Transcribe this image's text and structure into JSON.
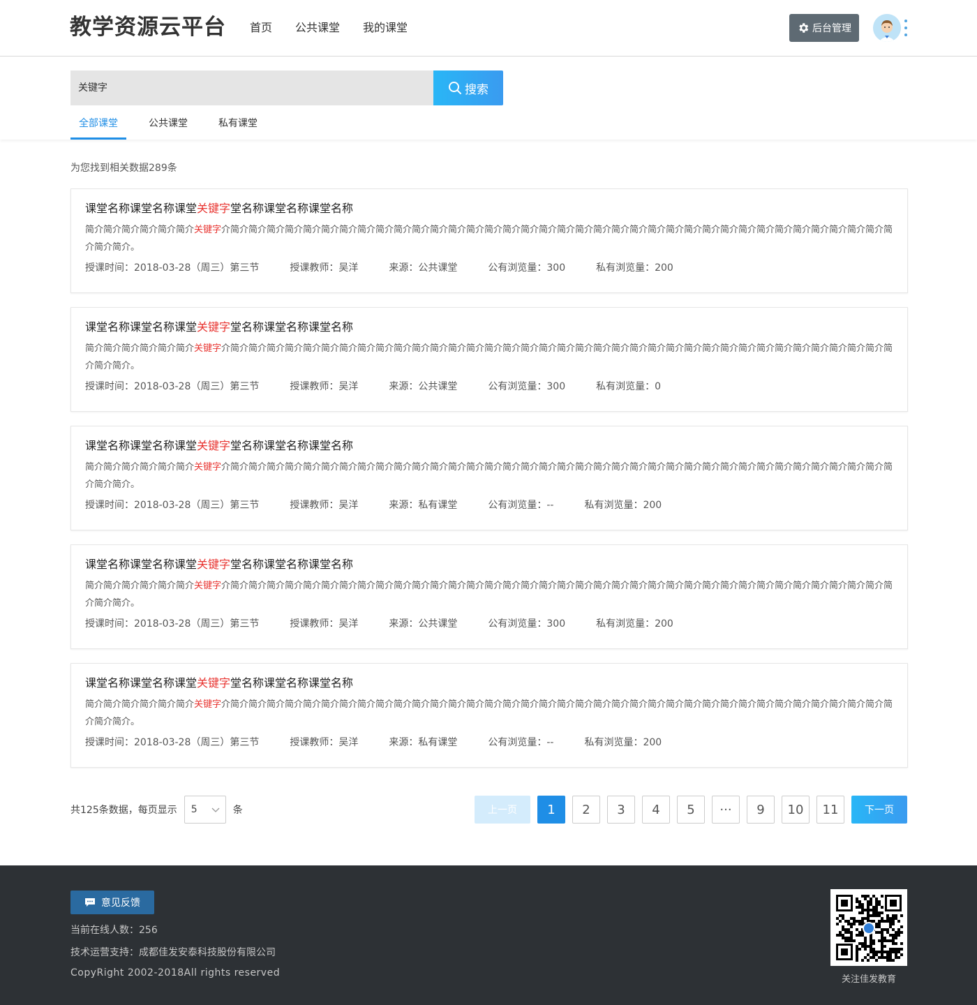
{
  "header": {
    "logo": "教学资源云平台",
    "nav": [
      "首页",
      "公共课堂",
      "我的课堂"
    ],
    "admin_label": "后台管理"
  },
  "search": {
    "placeholder": "关键字",
    "button_label": "搜索"
  },
  "tabs": [
    {
      "label": "全部课堂",
      "active": true
    },
    {
      "label": "公共课堂",
      "active": false
    },
    {
      "label": "私有课堂",
      "active": false
    }
  ],
  "result_count": "为您找到相关数据289条",
  "cards": [
    {
      "title_pre": "课堂名称课堂名称课堂",
      "title_kw": "关键字",
      "title_post": "堂名称课堂名称课堂名称",
      "desc_pre": "简介简介简介简介简介简介",
      "desc_kw": "关键字",
      "desc_post": "介简介简介简介简介简介简介简介简介简介简介简介简介简介简介简介简介简介简介简介简介简介简介简介简介简介简介简介简介简介简介简介简介简介简介简介简介简介简介简介。",
      "time": "授课时间：2018-03-28（周三）第三节",
      "teacher": "授课教师：吴洋",
      "source": "来源：公共课堂",
      "public_views": "公有浏览量：300",
      "private_views": "私有浏览量：200"
    },
    {
      "title_pre": "课堂名称课堂名称课堂",
      "title_kw": "关键字",
      "title_post": "堂名称课堂名称课堂名称",
      "desc_pre": "简介简介简介简介简介简介",
      "desc_kw": "关键字",
      "desc_post": "介简介简介简介简介简介简介简介简介简介简介简介简介简介简介简介简介简介简介简介简介简介简介简介简介简介简介简介简介简介简介简介简介简介简介简介简介简介简介简介。",
      "time": "授课时间：2018-03-28（周三）第三节",
      "teacher": "授课教师：吴洋",
      "source": "来源：公共课堂",
      "public_views": "公有浏览量：300",
      "private_views": "私有浏览量：0"
    },
    {
      "title_pre": "课堂名称课堂名称课堂",
      "title_kw": "关键字",
      "title_post": "堂名称课堂名称课堂名称",
      "desc_pre": "简介简介简介简介简介简介",
      "desc_kw": "关键字",
      "desc_post": "介简介简介简介简介简介简介简介简介简介简介简介简介简介简介简介简介简介简介简介简介简介简介简介简介简介简介简介简介简介简介简介简介简介简介简介简介简介简介简介。",
      "time": "授课时间：2018-03-28（周三）第三节",
      "teacher": "授课教师：吴洋",
      "source": "来源：私有课堂",
      "public_views": "公有浏览量：--",
      "private_views": "私有浏览量：200"
    },
    {
      "title_pre": "课堂名称课堂名称课堂",
      "title_kw": "关键字",
      "title_post": "堂名称课堂名称课堂名称",
      "desc_pre": "简介简介简介简介简介简介",
      "desc_kw": "关键字",
      "desc_post": "介简介简介简介简介简介简介简介简介简介简介简介简介简介简介简介简介简介简介简介简介简介简介简介简介简介简介简介简介简介简介简介简介简介简介简介简介简介简介简介。",
      "time": "授课时间：2018-03-28（周三）第三节",
      "teacher": "授课教师：吴洋",
      "source": "来源：公共课堂",
      "public_views": "公有浏览量：300",
      "private_views": "私有浏览量：200"
    },
    {
      "title_pre": "课堂名称课堂名称课堂",
      "title_kw": "关键字",
      "title_post": "堂名称课堂名称课堂名称",
      "desc_pre": "简介简介简介简介简介简介",
      "desc_kw": "关键字",
      "desc_post": "介简介简介简介简介简介简介简介简介简介简介简介简介简介简介简介简介简介简介简介简介简介简介简介简介简介简介简介简介简介简介简介简介简介简介简介简介简介简介简介。",
      "time": "授课时间：2018-03-28（周三）第三节",
      "teacher": "授课教师：吴洋",
      "source": "来源：私有课堂",
      "public_views": "公有浏览量：--",
      "private_views": "私有浏览量：200"
    }
  ],
  "pagination": {
    "total_prefix": "共125条数据，每页显示",
    "page_size": "5",
    "total_suffix": "条",
    "prev": "上一页",
    "pages": [
      "1",
      "2",
      "3",
      "4",
      "5",
      "···",
      "9",
      "10",
      "11"
    ],
    "current": "1",
    "next": "下一页"
  },
  "footer": {
    "feedback": "意见反馈",
    "online": "当前在线人数：256",
    "support": "技术运营支持：成都佳发安泰科技股份有限公司",
    "copyright": "CopyRight 2002-2018All rights reserved",
    "qr_label": "关注佳发教育"
  },
  "colors": {
    "accent": "#1f8ee6",
    "keyword": "#e8332f",
    "footer_bg": "#2d3135",
    "admin_btn": "#5e6a73"
  }
}
